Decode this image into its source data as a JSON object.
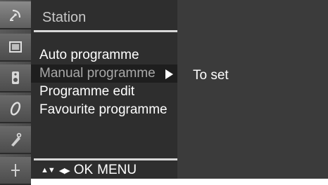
{
  "sidebar": {
    "icons": [
      "satellite-dish-icon",
      "picture-icon",
      "sound-icon",
      "time-icon",
      "special-icon",
      "setup-icon"
    ]
  },
  "panel": {
    "title": "Station",
    "items": [
      {
        "label": "Auto programme",
        "selected": false
      },
      {
        "label": "Manual programme",
        "selected": true
      },
      {
        "label": "Programme edit",
        "selected": false
      },
      {
        "label": "Favourite programme",
        "selected": false
      }
    ],
    "footer": {
      "updown": "▲▼",
      "leftright": "◀▶",
      "ok": "OK",
      "menu": "MENU"
    }
  },
  "submenu": {
    "text": "To set"
  },
  "colors": {
    "panel_bg": "#2e2e2e",
    "selected_bg": "#1e1e1e",
    "submenu_bg": "#3b3b3b"
  }
}
